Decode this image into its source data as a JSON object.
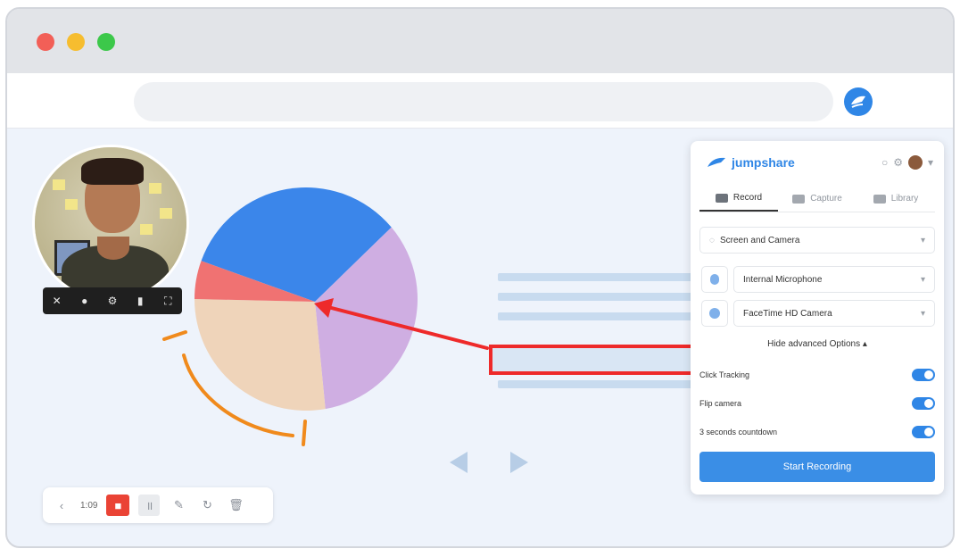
{
  "panel": {
    "brand": "jumpshare",
    "tabs": [
      {
        "label": "Record",
        "active": true
      },
      {
        "label": "Capture",
        "active": false
      },
      {
        "label": "Library",
        "active": false
      }
    ],
    "capture_mode": "Screen and Camera",
    "microphone": "Internal Microphone",
    "camera": "FaceTime HD Camera",
    "advanced_link": "Hide advanced Options",
    "options": [
      {
        "label": "Click Tracking",
        "enabled": true
      },
      {
        "label": "Flip camera",
        "enabled": true
      },
      {
        "label": "3 seconds countdown",
        "enabled": true
      }
    ],
    "start_button": "Start Recording"
  },
  "draw_toolbar": {
    "timer": "1:09"
  },
  "pie_colors": [
    "#3b86ea",
    "#cfaee2",
    "#efd4ba",
    "#f07272"
  ],
  "colors": {
    "accent": "#2f86e6",
    "annotation_red": "#ee2a2a",
    "annotation_orange": "#f08a1c"
  }
}
